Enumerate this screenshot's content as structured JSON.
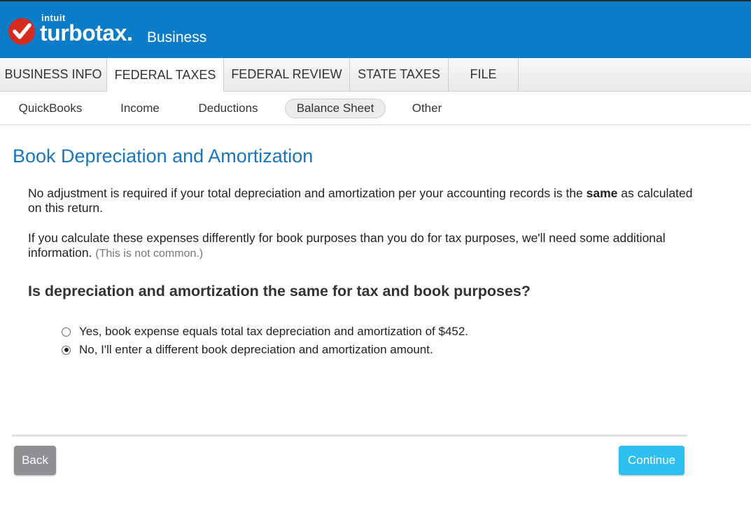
{
  "header": {
    "brand_intuit": "intuit",
    "brand_name": "turbotax",
    "brand_dot": ".",
    "brand_product": "Business",
    "brand_color": "#0d7cc8",
    "check_color": "#d52b1e"
  },
  "tabs": [
    {
      "label": "BUSINESS INFO",
      "active": false
    },
    {
      "label": "FEDERAL TAXES",
      "active": true
    },
    {
      "label": "FEDERAL REVIEW",
      "active": false
    },
    {
      "label": "STATE TAXES",
      "active": false
    },
    {
      "label": "FILE",
      "active": false
    }
  ],
  "subnav": [
    {
      "label": "QuickBooks",
      "active": false
    },
    {
      "label": "Income",
      "active": false
    },
    {
      "label": "Deductions",
      "active": false
    },
    {
      "label": "Balance Sheet",
      "active": true
    },
    {
      "label": "Other",
      "active": false
    }
  ],
  "main": {
    "title": "Book Depreciation and Amortization",
    "para1_before": "No adjustment is required if your total depreciation and amortization per your accounting records is the ",
    "para1_bold": "same",
    "para1_after": " as calculated on this return.",
    "para2": "If you calculate these expenses differently for book purposes than you do for tax purposes, we'll need some additional information. ",
    "para2_note": "(This is not common.)",
    "question": "Is depreciation and amortization the same for tax and book purposes?",
    "options": [
      {
        "label": "Yes, book expense equals total tax depreciation and amortization of $452.",
        "selected": false
      },
      {
        "label": "No, I'll enter a different book depreciation and amortization amount.",
        "selected": true
      }
    ]
  },
  "footer": {
    "back_label": "Back",
    "continue_label": "Continue"
  }
}
